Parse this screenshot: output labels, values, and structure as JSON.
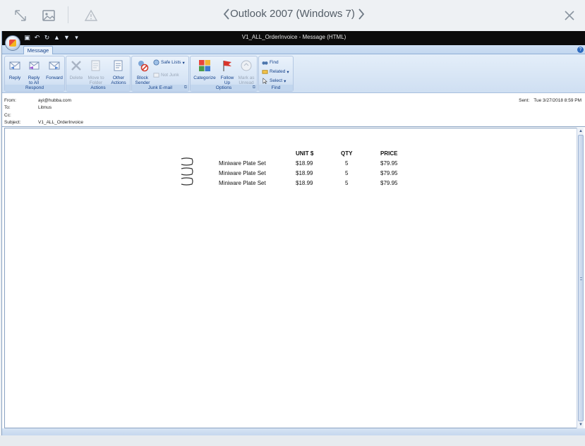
{
  "viewer": {
    "title": "Outlook 2007 (Windows 7)",
    "icons": [
      "expand-icon",
      "image-icon",
      "warning-icon",
      "prev-icon",
      "next-icon",
      "close-icon"
    ]
  },
  "window": {
    "title": "V1_ALL_OrderInvoice - Message (HTML)",
    "active_tab": "Message"
  },
  "ribbon": {
    "respond": {
      "label": "Respond",
      "reply": "Reply",
      "reply_all_1": "Reply",
      "reply_all_2": "to All",
      "forward": "Forward"
    },
    "actions": {
      "label": "Actions",
      "delete": "Delete",
      "move_1": "Move to",
      "move_2": "Folder",
      "other_1": "Other",
      "other_2": "Actions"
    },
    "junk": {
      "label": "Junk E-mail",
      "block_1": "Block",
      "block_2": "Sender",
      "safe_lists": "Safe Lists",
      "not_junk": "Not Junk"
    },
    "options": {
      "label": "Options",
      "categorize": "Categorize",
      "follow_1": "Follow",
      "follow_2": "Up",
      "mark_1": "Mark as",
      "mark_2": "Unread"
    },
    "find": {
      "label": "Find",
      "find": "Find",
      "related": "Related",
      "select": "Select"
    }
  },
  "message": {
    "from_label": "From:",
    "from": "ayi@hubba.com",
    "to_label": "To:",
    "to": "Litmus",
    "cc_label": "Cc:",
    "cc": "",
    "subject_label": "Subject:",
    "subject": "V1_ALL_OrderInvoice",
    "sent_label": "Sent:",
    "sent": "Tue 3/27/2018 8:59 PM"
  },
  "order": {
    "headers": {
      "unit": "UNIT $",
      "qty": "QTY",
      "price": "PRICE"
    },
    "rows": [
      {
        "name": "Miniware Plate Set",
        "unit": "$18.99",
        "qty": "5",
        "price": "$79.95"
      },
      {
        "name": "Miniware Plate Set",
        "unit": "$18.99",
        "qty": "5",
        "price": "$79.95"
      },
      {
        "name": "Miniware Plate Set",
        "unit": "$18.99",
        "qty": "5",
        "price": "$79.95"
      }
    ]
  }
}
